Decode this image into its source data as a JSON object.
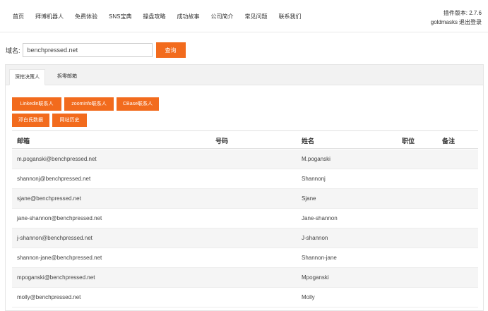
{
  "nav": [
    "首页",
    "拜博机器人",
    "免费体验",
    "SNS宝典",
    "操盘攻略",
    "成功故事",
    "公司简介",
    "常见问题",
    "联系我们"
  ],
  "version": {
    "label": "插件版本: 2.7.6",
    "user": "goldmasks",
    "logout": "退出登录"
  },
  "search": {
    "label": "域名:",
    "value": "benchpressed.net",
    "button": "查询"
  },
  "tabs": [
    "深挖决策人",
    "拆零邮箱"
  ],
  "buttons": [
    "Linkedin联系人",
    "zoominfo联系人",
    "CBase联系人",
    "邓白氏数据",
    "网站历史"
  ],
  "table": {
    "headers": [
      "邮箱",
      "号码",
      "姓名",
      "职位",
      "备注"
    ],
    "rows": [
      [
        "m.poganski@benchpressed.net",
        "",
        "M.poganski",
        "",
        ""
      ],
      [
        "shannonj@benchpressed.net",
        "",
        "Shannonj",
        "",
        ""
      ],
      [
        "sjane@benchpressed.net",
        "",
        "Sjane",
        "",
        ""
      ],
      [
        "jane-shannon@benchpressed.net",
        "",
        "Jane-shannon",
        "",
        ""
      ],
      [
        "j-shannon@benchpressed.net",
        "",
        "J-shannon",
        "",
        ""
      ],
      [
        "shannon-jane@benchpressed.net",
        "",
        "Shannon-jane",
        "",
        ""
      ],
      [
        "mpoganski@benchpressed.net",
        "",
        "Mpoganski",
        "",
        ""
      ],
      [
        "molly@benchpressed.net",
        "",
        "Molly",
        "",
        ""
      ]
    ]
  },
  "colors": {
    "accent": "#f26b1d",
    "row_alt": "#f5f5f5"
  }
}
